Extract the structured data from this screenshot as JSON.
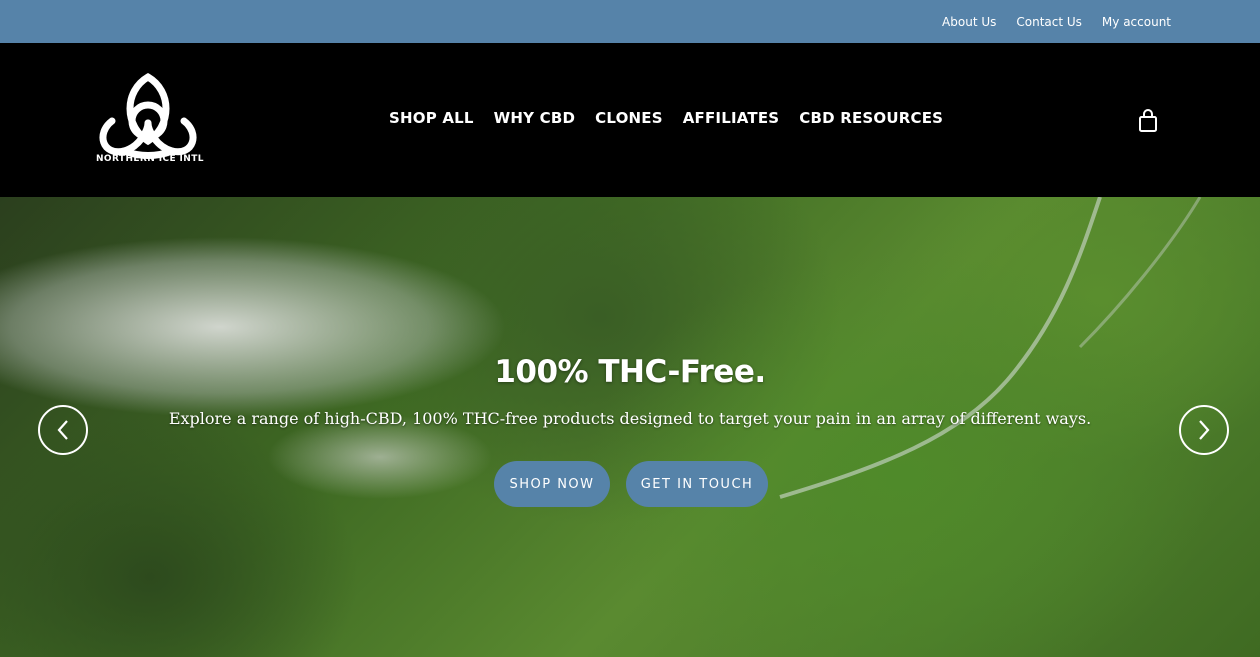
{
  "topbar": {
    "links": [
      "About Us",
      "Contact Us",
      "My account"
    ]
  },
  "header": {
    "logo_text": "NORTHERN ICE INTL",
    "nav": [
      "SHOP ALL",
      "WHY CBD",
      "CLONES",
      "AFFILIATES",
      "CBD RESOURCES"
    ],
    "cart_icon": "shopping-bag-icon"
  },
  "hero": {
    "title": "100% THC-Free.",
    "subtitle": "Explore a range of high-CBD, 100% THC-free products designed to target your pain in an array of different ways.",
    "primary_button": "SHOP NOW",
    "secondary_button": "GET IN TOUCH",
    "prev_icon": "chevron-left-icon",
    "next_icon": "chevron-right-icon"
  },
  "colors": {
    "topbar_bg": "#5683a9",
    "header_bg": "#000000",
    "button_bg": "#5683a9"
  }
}
